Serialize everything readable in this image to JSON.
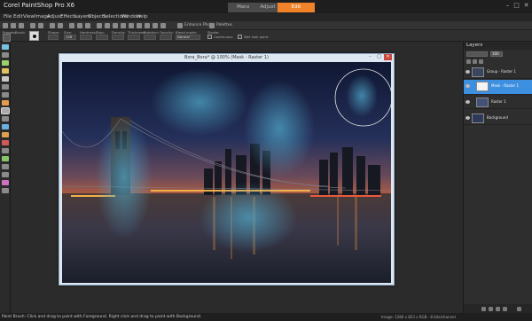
{
  "app": {
    "title": "Corel PaintShop Pro X6",
    "workspace_tabs": [
      "Manage",
      "Adjust",
      "Edit"
    ],
    "active_tab": "Edit",
    "accent_color": "#f0832a"
  },
  "menu": [
    "File",
    "Edit",
    "View",
    "Image",
    "Adjust",
    "Effects",
    "Layers",
    "Objects",
    "Selections",
    "Window",
    "Help"
  ],
  "toolbar": {
    "enhance_label": "Enhance Photo",
    "palettes_label": "Palettes"
  },
  "options": {
    "presets_label": "Presets:",
    "brush_label": "Brush",
    "shape_label": "Shape:",
    "size_label": "Size:",
    "size_value": "128",
    "hardness_label": "Hardness:",
    "step_label": "Step:",
    "density_label": "Density:",
    "thickness_label": "Thickness:",
    "rotation_label": "Rotation:",
    "opacity_label": "Opacity:",
    "blend_mode_label": "Blend mode:",
    "blend_mode_value": "Normal",
    "stroke_label": "Stroke:",
    "continuous_label": "Continuous",
    "wet_look_label": "Wet look paint"
  },
  "document": {
    "title": "Bora_Bora* @ 100% (Mask - Raster 1)"
  },
  "layers": {
    "title": "Layers",
    "opacity_value": "100",
    "items": [
      {
        "name": "Group - Raster 1",
        "selected": false
      },
      {
        "name": "Mask - Raster 1",
        "selected": true
      },
      {
        "name": "Raster 1",
        "selected": false
      },
      {
        "name": "Background",
        "selected": false
      }
    ]
  },
  "status": {
    "text": "Paint Brush: Click and drag to paint with Foreground. Right click and drag to paint with Background.",
    "info": "Image: 1280 x 853 x RGB - 8 bits/channel"
  }
}
